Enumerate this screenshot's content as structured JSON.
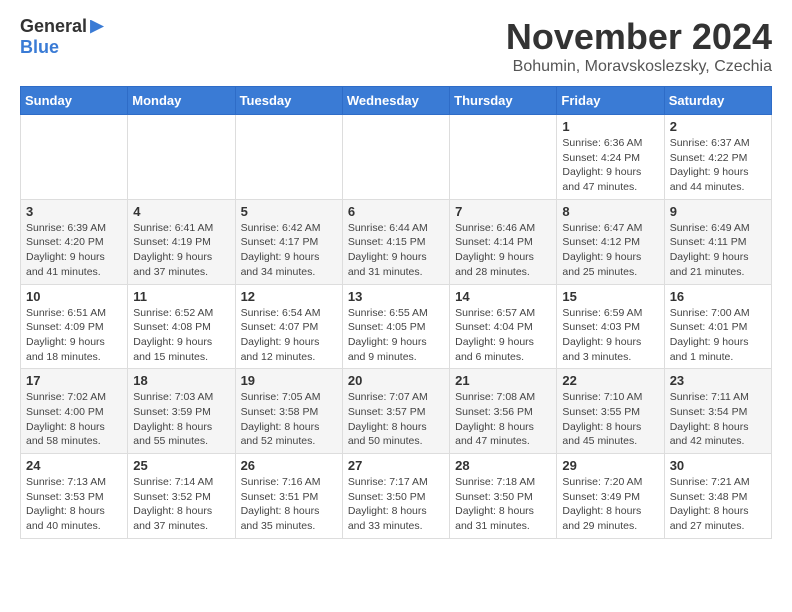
{
  "logo": {
    "general": "General",
    "blue": "Blue"
  },
  "title": "November 2024",
  "location": "Bohumin, Moravskoslezsky, Czechia",
  "weekdays": [
    "Sunday",
    "Monday",
    "Tuesday",
    "Wednesday",
    "Thursday",
    "Friday",
    "Saturday"
  ],
  "weeks": [
    [
      null,
      null,
      null,
      null,
      null,
      {
        "day": 1,
        "sunrise": "6:36 AM",
        "sunset": "4:24 PM",
        "daylight": "9 hours and 47 minutes."
      },
      {
        "day": 2,
        "sunrise": "6:37 AM",
        "sunset": "4:22 PM",
        "daylight": "9 hours and 44 minutes."
      }
    ],
    [
      {
        "day": 3,
        "sunrise": "6:39 AM",
        "sunset": "4:20 PM",
        "daylight": "9 hours and 41 minutes."
      },
      {
        "day": 4,
        "sunrise": "6:41 AM",
        "sunset": "4:19 PM",
        "daylight": "9 hours and 37 minutes."
      },
      {
        "day": 5,
        "sunrise": "6:42 AM",
        "sunset": "4:17 PM",
        "daylight": "9 hours and 34 minutes."
      },
      {
        "day": 6,
        "sunrise": "6:44 AM",
        "sunset": "4:15 PM",
        "daylight": "9 hours and 31 minutes."
      },
      {
        "day": 7,
        "sunrise": "6:46 AM",
        "sunset": "4:14 PM",
        "daylight": "9 hours and 28 minutes."
      },
      {
        "day": 8,
        "sunrise": "6:47 AM",
        "sunset": "4:12 PM",
        "daylight": "9 hours and 25 minutes."
      },
      {
        "day": 9,
        "sunrise": "6:49 AM",
        "sunset": "4:11 PM",
        "daylight": "9 hours and 21 minutes."
      }
    ],
    [
      {
        "day": 10,
        "sunrise": "6:51 AM",
        "sunset": "4:09 PM",
        "daylight": "9 hours and 18 minutes."
      },
      {
        "day": 11,
        "sunrise": "6:52 AM",
        "sunset": "4:08 PM",
        "daylight": "9 hours and 15 minutes."
      },
      {
        "day": 12,
        "sunrise": "6:54 AM",
        "sunset": "4:07 PM",
        "daylight": "9 hours and 12 minutes."
      },
      {
        "day": 13,
        "sunrise": "6:55 AM",
        "sunset": "4:05 PM",
        "daylight": "9 hours and 9 minutes."
      },
      {
        "day": 14,
        "sunrise": "6:57 AM",
        "sunset": "4:04 PM",
        "daylight": "9 hours and 6 minutes."
      },
      {
        "day": 15,
        "sunrise": "6:59 AM",
        "sunset": "4:03 PM",
        "daylight": "9 hours and 3 minutes."
      },
      {
        "day": 16,
        "sunrise": "7:00 AM",
        "sunset": "4:01 PM",
        "daylight": "9 hours and 1 minute."
      }
    ],
    [
      {
        "day": 17,
        "sunrise": "7:02 AM",
        "sunset": "4:00 PM",
        "daylight": "8 hours and 58 minutes."
      },
      {
        "day": 18,
        "sunrise": "7:03 AM",
        "sunset": "3:59 PM",
        "daylight": "8 hours and 55 minutes."
      },
      {
        "day": 19,
        "sunrise": "7:05 AM",
        "sunset": "3:58 PM",
        "daylight": "8 hours and 52 minutes."
      },
      {
        "day": 20,
        "sunrise": "7:07 AM",
        "sunset": "3:57 PM",
        "daylight": "8 hours and 50 minutes."
      },
      {
        "day": 21,
        "sunrise": "7:08 AM",
        "sunset": "3:56 PM",
        "daylight": "8 hours and 47 minutes."
      },
      {
        "day": 22,
        "sunrise": "7:10 AM",
        "sunset": "3:55 PM",
        "daylight": "8 hours and 45 minutes."
      },
      {
        "day": 23,
        "sunrise": "7:11 AM",
        "sunset": "3:54 PM",
        "daylight": "8 hours and 42 minutes."
      }
    ],
    [
      {
        "day": 24,
        "sunrise": "7:13 AM",
        "sunset": "3:53 PM",
        "daylight": "8 hours and 40 minutes."
      },
      {
        "day": 25,
        "sunrise": "7:14 AM",
        "sunset": "3:52 PM",
        "daylight": "8 hours and 37 minutes."
      },
      {
        "day": 26,
        "sunrise": "7:16 AM",
        "sunset": "3:51 PM",
        "daylight": "8 hours and 35 minutes."
      },
      {
        "day": 27,
        "sunrise": "7:17 AM",
        "sunset": "3:50 PM",
        "daylight": "8 hours and 33 minutes."
      },
      {
        "day": 28,
        "sunrise": "7:18 AM",
        "sunset": "3:50 PM",
        "daylight": "8 hours and 31 minutes."
      },
      {
        "day": 29,
        "sunrise": "7:20 AM",
        "sunset": "3:49 PM",
        "daylight": "8 hours and 29 minutes."
      },
      {
        "day": 30,
        "sunrise": "7:21 AM",
        "sunset": "3:48 PM",
        "daylight": "8 hours and 27 minutes."
      }
    ]
  ]
}
